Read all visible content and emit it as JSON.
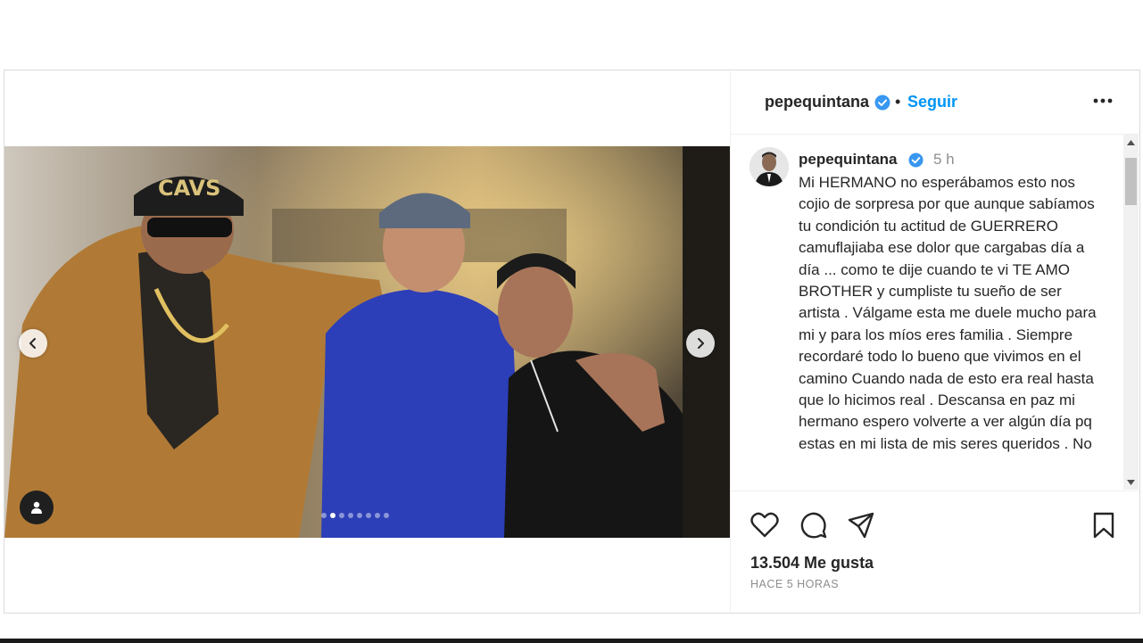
{
  "post": {
    "author": "pepequintana",
    "follow_label": "Seguir",
    "separator": "•",
    "caption_time": "5 h",
    "caption": "Mi HERMANO no esperábamos esto nos cojio de sorpresa por que aunque sabíamos tu condición tu actitud de GUERRERO camuflajiaba ese dolor que cargabas día a día ... como te dije cuando te vi TE AMO BROTHER y cumpliste tu sueño de ser artista . Válgame esta me duele mucho para mi y para los míos eres familia . Siempre recordaré todo lo bueno que vivimos en el camino Cuando nada de esto era real hasta que lo hicimos real . Descansa en paz mi hermano espero volverte a ver algún día pq estas en mi lista de mis seres queridos . No",
    "likes": "13.504 Me gusta",
    "time_ago": "HACE 5 HORAS"
  },
  "carousel": {
    "total_slides": 8,
    "active_index": 1
  },
  "icons": {
    "verified": "verified-badge-icon",
    "more": "more-options-icon",
    "prev": "chevron-left-icon",
    "next": "chevron-right-icon",
    "tag": "user-tag-icon",
    "like": "heart-icon",
    "comment": "comment-icon",
    "share": "paper-plane-icon",
    "save": "bookmark-icon"
  },
  "colors": {
    "link": "#0095f6",
    "verified": "#3897f0",
    "text": "#262626",
    "muted": "#8e8e8e"
  }
}
